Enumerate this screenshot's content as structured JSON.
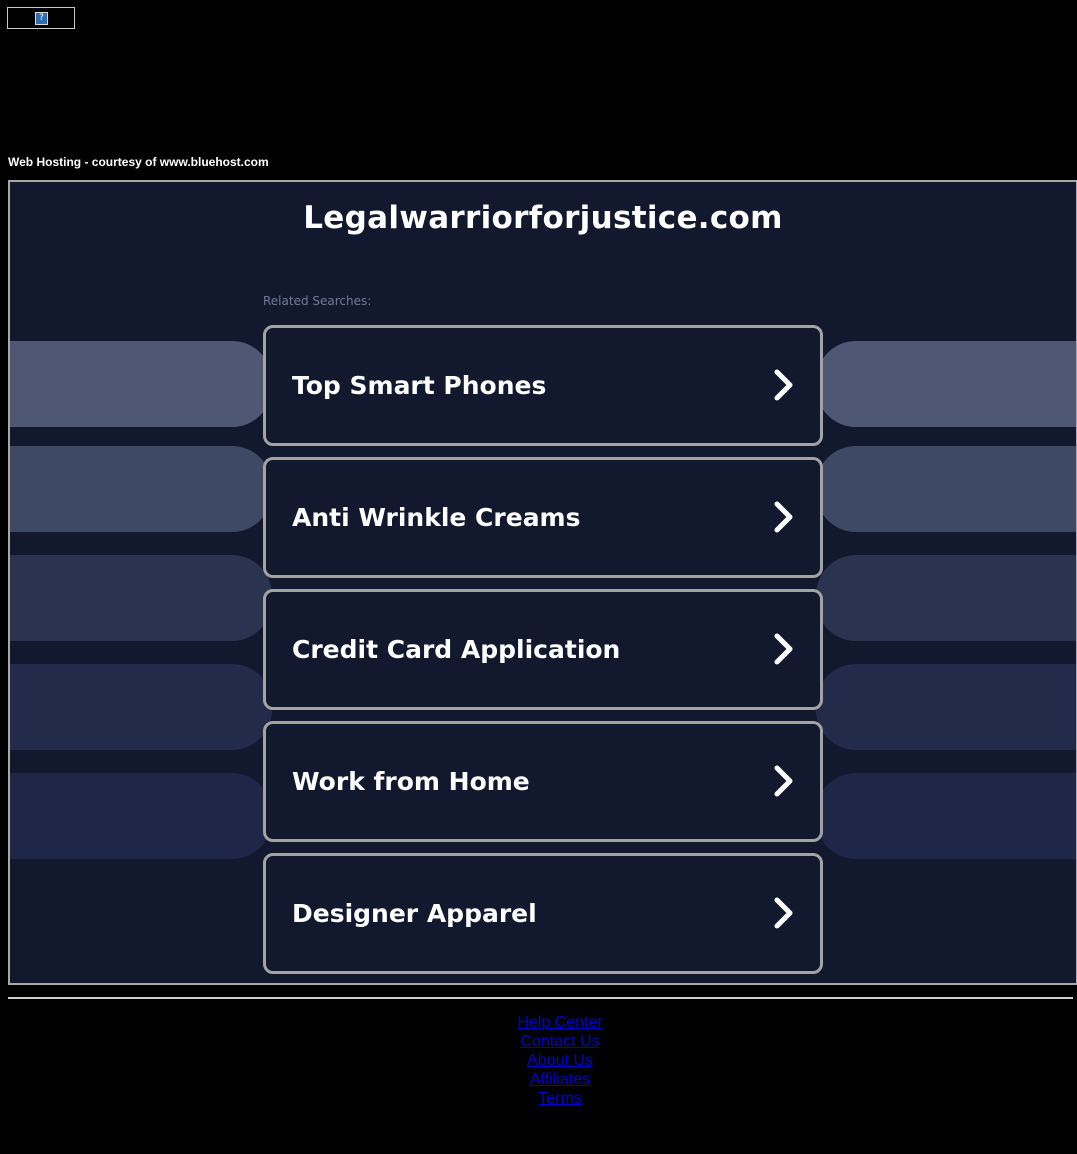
{
  "banner": {
    "icon": "question-mark-icon",
    "glyph": "?"
  },
  "courtesy_text": "Web Hosting - courtesy of www.bluehost.com",
  "main": {
    "site_title": "Legalwarriorforjustice.com",
    "related_label": "Related Searches:",
    "searches": [
      {
        "label": "Top Smart Phones",
        "icon": "chevron-right-icon"
      },
      {
        "label": "Anti Wrinkle Creams",
        "icon": "chevron-right-icon"
      },
      {
        "label": "Credit Card Application",
        "icon": "chevron-right-icon"
      },
      {
        "label": "Work from Home",
        "icon": "chevron-right-icon"
      },
      {
        "label": "Designer Apparel",
        "icon": "chevron-right-icon"
      }
    ]
  },
  "footer": {
    "links": [
      "Help Center",
      "Contact Us",
      "About Us",
      "Affiliates",
      "Terms"
    ]
  },
  "colors": {
    "page_background": "#000000",
    "panel_background": "#12182d",
    "card_border": "#a3a3a3",
    "link": "#0000cc",
    "decor_pills": [
      "#4e5874",
      "#3e4965",
      "#2a3350",
      "#222c4a",
      "#1e2747"
    ]
  }
}
